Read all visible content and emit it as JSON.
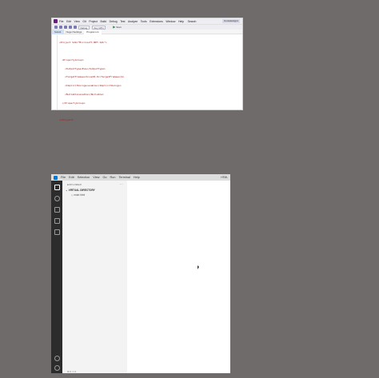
{
  "vs": {
    "menu": [
      "File",
      "Edit",
      "View",
      "Git",
      "Project",
      "Build",
      "Debug",
      "Test",
      "Analyze",
      "Tools",
      "Extensions",
      "Window",
      "Help"
    ],
    "search": "Search",
    "project_badge": "ConsoleApp1",
    "toolbar": {
      "config": "Debug",
      "platform": "Any CPU",
      "run_label": "Start"
    },
    "tabs": [
      "Solut1",
      "Nuget Settings",
      "Program.cs"
    ],
    "code_lines": [
      "<Project Sdk=\"Microsoft.NET.Sdk\">",
      "",
      "  <PropertyGroup>",
      "    <OutputType>Exe</OutputType>",
      "    <TargetFramework>net8.0</TargetFramework>",
      "    <ImplicitUsings>enable</ImplicitUsings>",
      "    <Nullable>enable</Nullable>",
      "  </PropertyGroup>",
      "",
      "</Project>"
    ]
  },
  "vsc": {
    "menu": [
      "File",
      "Edit",
      "Selection",
      "View",
      "Go",
      "Run",
      "Terminal",
      "Help"
    ],
    "title_right": "HTML",
    "sidebar_header": "EXPLORER",
    "more": "···",
    "folder": "VIRTUAL DIRECTORY",
    "file": "main.html",
    "status_text": "⊗ 0 ⚠ 0"
  }
}
